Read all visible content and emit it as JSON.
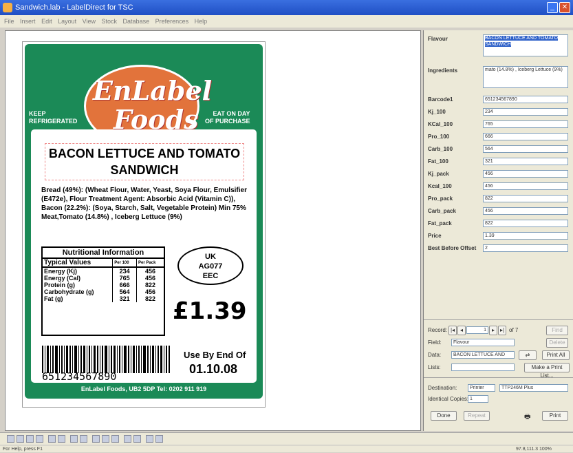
{
  "window": {
    "title": "Sandwich.lab - LabelDirect for TSC",
    "close_glyph": "✕",
    "minimize_glyph": "_"
  },
  "menu": [
    "File",
    "Insert",
    "Edit",
    "Layout",
    "View",
    "Stock",
    "Database",
    "Preferences",
    "Help"
  ],
  "label": {
    "left_text": "KEEP\nREFRIGERATED",
    "right_text": "EAT ON DAY\nOF PURCHASE",
    "logo_en": "EnLabel",
    "logo_foods": "Foods",
    "product": "BACON LETTUCE AND TOMATO SANDWICH",
    "ingredients": "Bread (49%): (Wheat Flour, Water, Yeast, Soya Flour, Emulsifier (E472e), Flour Treatment Agent: Absorbic Acid (Vitamin C)), Bacon (22.2%): (Soya, Starch, Salt, Vegetable Protein) Min 75% Meat,Tomato (14.8%) , Iceberg Lettuce (9%)",
    "nutrition_title": "Nutritional Information",
    "nutrition_header": [
      "Typical Values",
      "Per 100",
      "Per Pack"
    ],
    "nutrition_rows": [
      [
        "Energy (Kj)",
        "234",
        "456"
      ],
      [
        "Energy (Cal)",
        "765",
        "456"
      ],
      [
        "Protein (g)",
        "666",
        "822"
      ],
      [
        "Carbohydrate (g)",
        "564",
        "456"
      ],
      [
        "Fat (g)",
        "321",
        "822"
      ]
    ],
    "uk_mark": [
      "UK",
      "AG077",
      "EEC"
    ],
    "price": "£1.39",
    "barcode_number": "651234567890",
    "use_by_label": "Use By End Of",
    "use_by_date": "01.10.08",
    "footer": "EnLabel Foods, UB2 5DP  Tel: 0202 911 919"
  },
  "panel": {
    "flavour_label": "Flavour",
    "flavour_value": "BACON LETTUCE AND TOMATO SANDWICH",
    "ingredients_label": "Ingredients",
    "ingredients_value": "mato (14.8%) , Iceberg Lettuce (9%)",
    "fields": [
      {
        "label": "Barcode1",
        "value": "651234567890"
      },
      {
        "label": "Kj_100",
        "value": "234"
      },
      {
        "label": "KCal_100",
        "value": "765"
      },
      {
        "label": "Pro_100",
        "value": "666"
      },
      {
        "label": "Carb_100",
        "value": "564"
      },
      {
        "label": "Fat_100",
        "value": "321"
      },
      {
        "label": "Kj_pack",
        "value": "456"
      },
      {
        "label": "Kcal_100",
        "value": "456"
      },
      {
        "label": "Pro_pack",
        "value": "822"
      },
      {
        "label": "Carb_pack",
        "value": "456"
      },
      {
        "label": "Fat_pack",
        "value": "822"
      },
      {
        "label": "Price",
        "value": "1.39"
      },
      {
        "label": "Best Before Offset",
        "value": "2"
      }
    ],
    "record_label": "Record:",
    "record_value": "1",
    "record_of": "of 7",
    "first_btn": "|◂",
    "prev_btn": "◂",
    "next_btn": "▸",
    "last_btn": "▸|",
    "find_btn": "Find",
    "delete_btn": "Delete",
    "field_label": "Field:",
    "field_value": "Flavour",
    "data_label": "Data:",
    "data_value": "BACON LETTUCE AND",
    "print_all": "Print All",
    "lists_label": "Lists:",
    "make_print_list": "Make a Print List...",
    "destination_label": "Destination:",
    "destination_value": "Printer",
    "printer_name": "TTP246M Plus",
    "copies_label": "Identical Copies:",
    "copies_value": "1",
    "done_btn": "Done",
    "repeat_btn": "Repeat",
    "print_btn": "Print"
  },
  "status": {
    "left": "For Help, press F1",
    "right": "97.8,111.3    100%"
  }
}
